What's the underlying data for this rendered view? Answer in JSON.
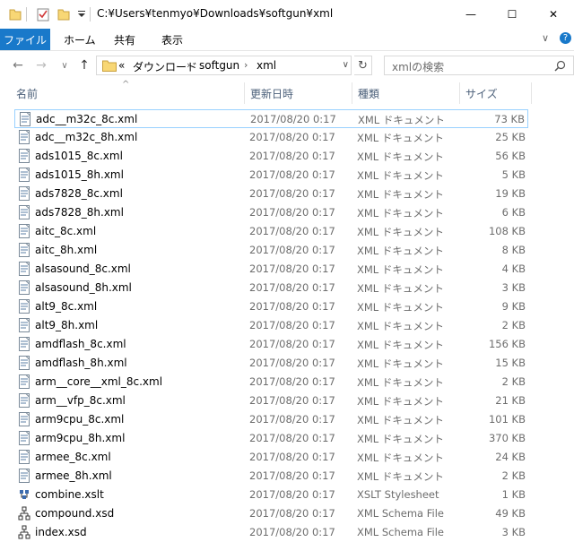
{
  "window": {
    "title": "C:¥Users¥tenmyo¥Downloads¥softgun¥xml",
    "minimize_glyph": "—",
    "maximize_glyph": "☐",
    "close_glyph": "✕"
  },
  "ribbon": {
    "tabs": [
      {
        "label": "ファイル",
        "active": true
      },
      {
        "label": "ホーム"
      },
      {
        "label": "共有"
      },
      {
        "label": "表示"
      }
    ],
    "expand_glyph": "∨",
    "help_glyph": "?"
  },
  "nav": {
    "back_glyph": "←",
    "forward_glyph": "→",
    "recent_glyph": "∨",
    "up_glyph": "↑",
    "breadcrumb": [
      {
        "label": "«"
      },
      {
        "label": "ダウンロード"
      },
      {
        "label": "softgun"
      },
      {
        "label": "xml"
      }
    ],
    "separator": "›",
    "refresh_glyph": "↻",
    "search_placeholder": "xmlの検索"
  },
  "columns": {
    "name": "名前",
    "date": "更新日時",
    "type": "種類",
    "size": "サイズ",
    "sort_glyph": "^"
  },
  "files": [
    {
      "name": "adc__m32c_8c.xml",
      "date": "2017/08/20 0:17",
      "type": "XML ドキュメント",
      "size": "73 KB",
      "icon": "xml-file-icon",
      "selected": true
    },
    {
      "name": "adc__m32c_8h.xml",
      "date": "2017/08/20 0:17",
      "type": "XML ドキュメント",
      "size": "25 KB",
      "icon": "xml-file-icon"
    },
    {
      "name": "ads1015_8c.xml",
      "date": "2017/08/20 0:17",
      "type": "XML ドキュメント",
      "size": "56 KB",
      "icon": "xml-file-icon"
    },
    {
      "name": "ads1015_8h.xml",
      "date": "2017/08/20 0:17",
      "type": "XML ドキュメント",
      "size": "5 KB",
      "icon": "xml-file-icon"
    },
    {
      "name": "ads7828_8c.xml",
      "date": "2017/08/20 0:17",
      "type": "XML ドキュメント",
      "size": "19 KB",
      "icon": "xml-file-icon"
    },
    {
      "name": "ads7828_8h.xml",
      "date": "2017/08/20 0:17",
      "type": "XML ドキュメント",
      "size": "6 KB",
      "icon": "xml-file-icon"
    },
    {
      "name": "aitc_8c.xml",
      "date": "2017/08/20 0:17",
      "type": "XML ドキュメント",
      "size": "108 KB",
      "icon": "xml-file-icon"
    },
    {
      "name": "aitc_8h.xml",
      "date": "2017/08/20 0:17",
      "type": "XML ドキュメント",
      "size": "8 KB",
      "icon": "xml-file-icon"
    },
    {
      "name": "alsasound_8c.xml",
      "date": "2017/08/20 0:17",
      "type": "XML ドキュメント",
      "size": "4 KB",
      "icon": "xml-file-icon"
    },
    {
      "name": "alsasound_8h.xml",
      "date": "2017/08/20 0:17",
      "type": "XML ドキュメント",
      "size": "3 KB",
      "icon": "xml-file-icon"
    },
    {
      "name": "alt9_8c.xml",
      "date": "2017/08/20 0:17",
      "type": "XML ドキュメント",
      "size": "9 KB",
      "icon": "xml-file-icon"
    },
    {
      "name": "alt9_8h.xml",
      "date": "2017/08/20 0:17",
      "type": "XML ドキュメント",
      "size": "2 KB",
      "icon": "xml-file-icon"
    },
    {
      "name": "amdflash_8c.xml",
      "date": "2017/08/20 0:17",
      "type": "XML ドキュメント",
      "size": "156 KB",
      "icon": "xml-file-icon"
    },
    {
      "name": "amdflash_8h.xml",
      "date": "2017/08/20 0:17",
      "type": "XML ドキュメント",
      "size": "15 KB",
      "icon": "xml-file-icon"
    },
    {
      "name": "arm__core__xml_8c.xml",
      "date": "2017/08/20 0:17",
      "type": "XML ドキュメント",
      "size": "2 KB",
      "icon": "xml-file-icon"
    },
    {
      "name": "arm__vfp_8c.xml",
      "date": "2017/08/20 0:17",
      "type": "XML ドキュメント",
      "size": "21 KB",
      "icon": "xml-file-icon"
    },
    {
      "name": "arm9cpu_8c.xml",
      "date": "2017/08/20 0:17",
      "type": "XML ドキュメント",
      "size": "101 KB",
      "icon": "xml-file-icon"
    },
    {
      "name": "arm9cpu_8h.xml",
      "date": "2017/08/20 0:17",
      "type": "XML ドキュメント",
      "size": "370 KB",
      "icon": "xml-file-icon"
    },
    {
      "name": "armee_8c.xml",
      "date": "2017/08/20 0:17",
      "type": "XML ドキュメント",
      "size": "24 KB",
      "icon": "xml-file-icon"
    },
    {
      "name": "armee_8h.xml",
      "date": "2017/08/20 0:17",
      "type": "XML ドキュメント",
      "size": "2 KB",
      "icon": "xml-file-icon"
    },
    {
      "name": "combine.xslt",
      "date": "2017/08/20 0:17",
      "type": "XSLT Stylesheet",
      "size": "1 KB",
      "icon": "xslt-file-icon"
    },
    {
      "name": "compound.xsd",
      "date": "2017/08/20 0:17",
      "type": "XML Schema File",
      "size": "49 KB",
      "icon": "xsd-file-icon"
    },
    {
      "name": "index.xsd",
      "date": "2017/08/20 0:17",
      "type": "XML Schema File",
      "size": "3 KB",
      "icon": "xsd-file-icon"
    }
  ]
}
